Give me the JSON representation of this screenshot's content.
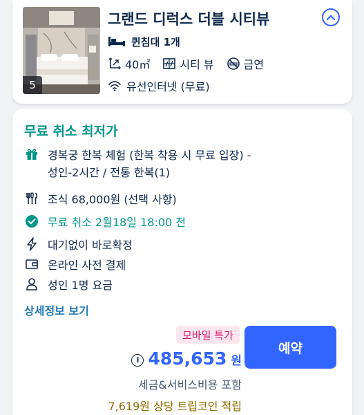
{
  "room": {
    "name": "그랜드 디럭스 더블 시티뷰",
    "photo_count": "5",
    "bed": "퀸침대 1개",
    "specs": [
      {
        "icon": "room-size-icon",
        "text": "40㎡"
      },
      {
        "icon": "window-view-icon",
        "text": "시티 뷰"
      },
      {
        "icon": "no-smoking-icon",
        "text": "금연"
      }
    ],
    "wifi": "유선인터넷 (무료)"
  },
  "rate": {
    "title": "무료 취소 최저가",
    "features": [
      {
        "icon": "gift-icon",
        "line1": "경복궁 한복 체험 (한복 착용 시 무료 입장) -",
        "line2": "성인-2시간 / 전통 한복(1)"
      },
      {
        "icon": "cutlery-icon",
        "line1": "조식 68,000원 (선택 사항)"
      },
      {
        "icon": "check-circle-icon",
        "line1": "무료 취소 2월18일 18:00 전",
        "highlight": true
      },
      {
        "icon": "lightning-icon",
        "line1": "대기없이 바로확정"
      },
      {
        "icon": "wallet-icon",
        "line1": "온라인 사전 결제"
      },
      {
        "icon": "person-icon",
        "line1": "성인 1명 요금"
      }
    ],
    "details_link": "상세정보 보기",
    "promo_badge": "모바일 특가",
    "info_symbol": "i",
    "price": "485,653",
    "currency": "원",
    "tax_note": "세금&서비스비용 포함",
    "coin_note": "7,619원 상당 트립코인 적립",
    "book_label": "예약"
  },
  "colors": {
    "accent_blue": "#3264ff",
    "teal": "#00968b",
    "link_blue": "#1a7ab6",
    "promo_pink": "#d9166f",
    "coin_gold": "#8f6e00"
  }
}
